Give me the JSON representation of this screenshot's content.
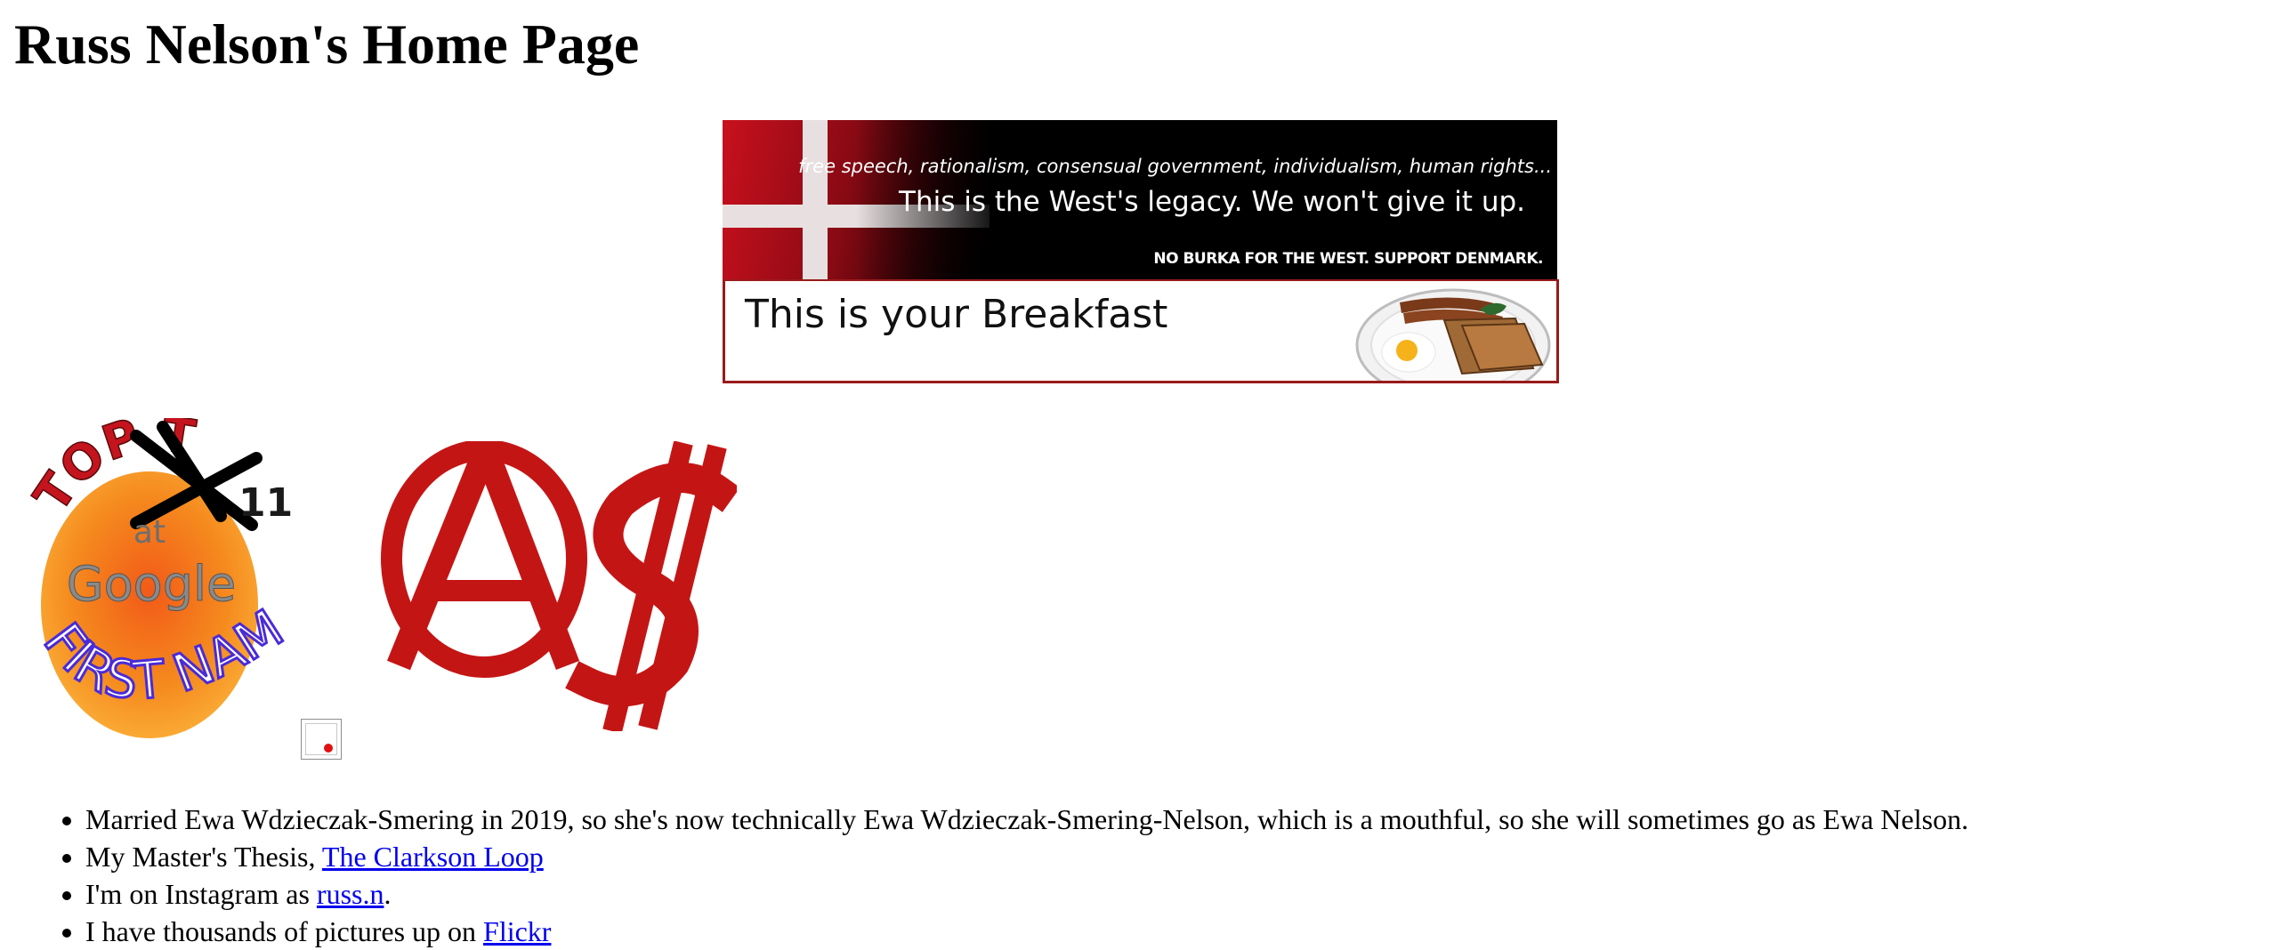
{
  "page": {
    "title": "Russ Nelson's Home Page"
  },
  "banners": {
    "west": {
      "tagline": "free speech, rationalism, consensual government, individualism, human rights...",
      "legacy": "This is the West's legacy. We won't give it up.",
      "support": "NO BURKA FOR THE WEST. SUPPORT DENMARK."
    },
    "breakfast": {
      "text": "This is your Breakfast"
    }
  },
  "badges": {
    "topten": {
      "top_word": "TOP TEN",
      "number": "11",
      "at": "at",
      "google": "Google",
      "first_names": "FIRST NAMES"
    }
  },
  "items": [
    {
      "text": "Married Ewa Wdzieczak-Smering in 2019, so she's now technically Ewa Wdzieczak-Smering-Nelson, which is a mouthful, so she will sometimes go as Ewa Nelson.",
      "link": "",
      "after": ""
    },
    {
      "text": "My Master's Thesis, ",
      "link": "The Clarkson Loop",
      "after": ""
    },
    {
      "text": "I'm on Instagram as ",
      "link": "russ.n",
      "after": "."
    },
    {
      "text": "I have thousands of pictures up on ",
      "link": "Flickr",
      "after": ""
    }
  ],
  "colors": {
    "link": "#0000ee",
    "anarcho_red": "#c41515",
    "banner_border": "#9a1a1a"
  }
}
